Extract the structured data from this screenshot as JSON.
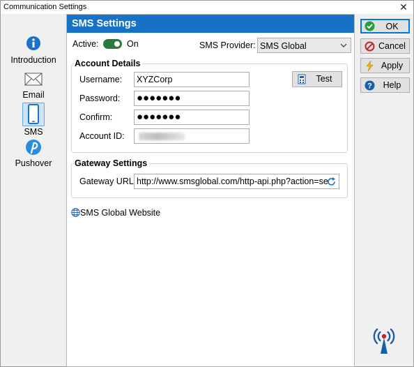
{
  "window": {
    "title": "Communication Settings",
    "close_glyph": "✕"
  },
  "sidebar": {
    "items": [
      {
        "label": "Introduction",
        "icon": "info-icon",
        "selected": false
      },
      {
        "label": "Email",
        "icon": "envelope-icon",
        "selected": false
      },
      {
        "label": "SMS",
        "icon": "phone-icon",
        "selected": true
      },
      {
        "label": "Pushover",
        "icon": "pushover-icon",
        "selected": false
      }
    ]
  },
  "panel": {
    "title": "SMS Settings",
    "active_label": "Active:",
    "active_state": "On",
    "active": true,
    "provider_label": "SMS Provider:",
    "provider_value": "SMS Global",
    "account": {
      "title": "Account Details",
      "username_label": "Username:",
      "username_value": "XYZCorp",
      "password_label": "Password:",
      "password_value": "●●●●●●●",
      "confirm_label": "Confirm:",
      "confirm_value": "●●●●●●●",
      "account_id_label": "Account ID:",
      "test_label": "Test"
    },
    "gateway": {
      "title": "Gateway Settings",
      "url_label": "Gateway URL:",
      "url_value": "http://www.smsglobal.com/http-api.php?action=se"
    },
    "website_link": "SMS Global Website"
  },
  "buttons": {
    "ok": "OK",
    "cancel": "Cancel",
    "apply": "Apply",
    "help": "Help"
  },
  "colors": {
    "header": "#1572c6",
    "toggle_on": "#2b7a3a",
    "selection": "#cde4f7"
  }
}
